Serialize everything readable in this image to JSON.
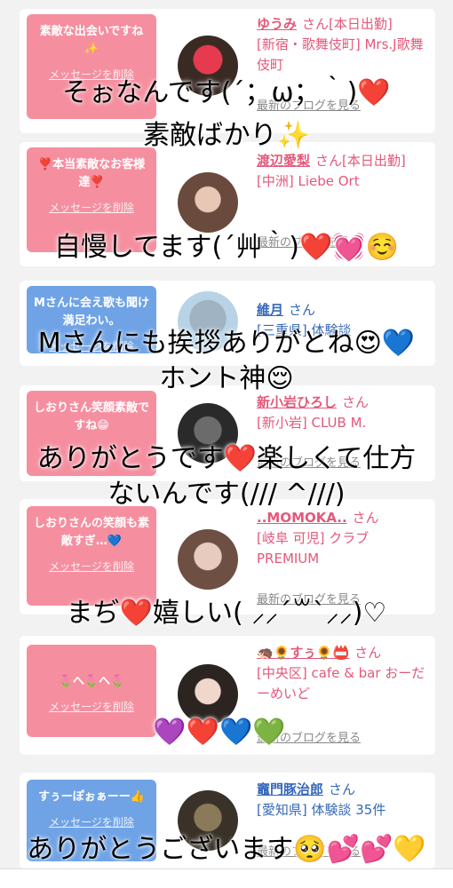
{
  "cards": [
    {
      "bubble": "素敵な出会いですね✨",
      "del": "メッセージを削除",
      "name": "ゆうみ",
      "san": "さん",
      "tag": "[本日出勤]",
      "loc": "[新宿・歌舞伎町] Mrs.J歌舞伎町",
      "blog": "最新のブログを見る"
    },
    {
      "bubble": "❣️本当素敵なお客様達❣️",
      "del": "メッセージを削除",
      "name": "渡辺愛梨",
      "san": "さん",
      "tag": "[本日出勤]",
      "loc": "[中洲] Liebe Ort",
      "blog": "最新のブログを見る"
    },
    {
      "bubble": "Mさんに会え歌も聞け満足わい。",
      "del": "メッセージを削除",
      "name": "維月",
      "san": "さん",
      "tag": "",
      "loc": "[三重県] 体験談",
      "blog": ""
    },
    {
      "bubble": "しおりさん笑顔素敵ですね😁",
      "del": "メッセージを削除",
      "name": "新小岩ひろし",
      "san": "さん",
      "tag": "",
      "loc": "[新小岩] CLUB M.",
      "blog": "最新のブログを見る"
    },
    {
      "bubble": "しおりさんの笑顔も素敵すぎ…💙",
      "del": "メッセージを削除",
      "name": "..MOMOKA..",
      "san": "さん",
      "tag": "",
      "loc": "[岐阜 可児] クラブPREMIUM",
      "blog": "最新のブログを見る"
    },
    {
      "bubble": "🌷へ🌷へ🌷",
      "del": "メッセージを削除",
      "name": "🦔🌻すぅ🌻📛",
      "san": "さん",
      "tag": "",
      "loc": "[中央区] cafe & bar おーだーめいど",
      "blog": "最新のブログを見る"
    },
    {
      "bubble": "すぅーぽぉぁーー👍",
      "del": "メッセージを削除",
      "name": "竈門豚治郎",
      "san": "さん",
      "tag": "",
      "loc": "[愛知県] 体験談 35件",
      "blog": "最新のブログを見る"
    }
  ],
  "overlay": {
    "l1": "そぉなんです(´；ω；｀)❤️",
    "l2": "素敵ばかり✨",
    "l3": "自慢してます(´艸｀)❤️💓☺️",
    "l4": "Mさんにも挨拶ありがとね😍💙",
    "l5": "ホント神😌",
    "l6": "ありがとうです❤️楽しくて仕方",
    "l7": "ないんです(/// ^///)",
    "l8": "まぢ❤️嬉しい( ⸝⸝´꒳`⸝⸝)♡",
    "l9": "💜❤️💙💚",
    "l10": "ありがとうございます🥺💕💕💛"
  }
}
